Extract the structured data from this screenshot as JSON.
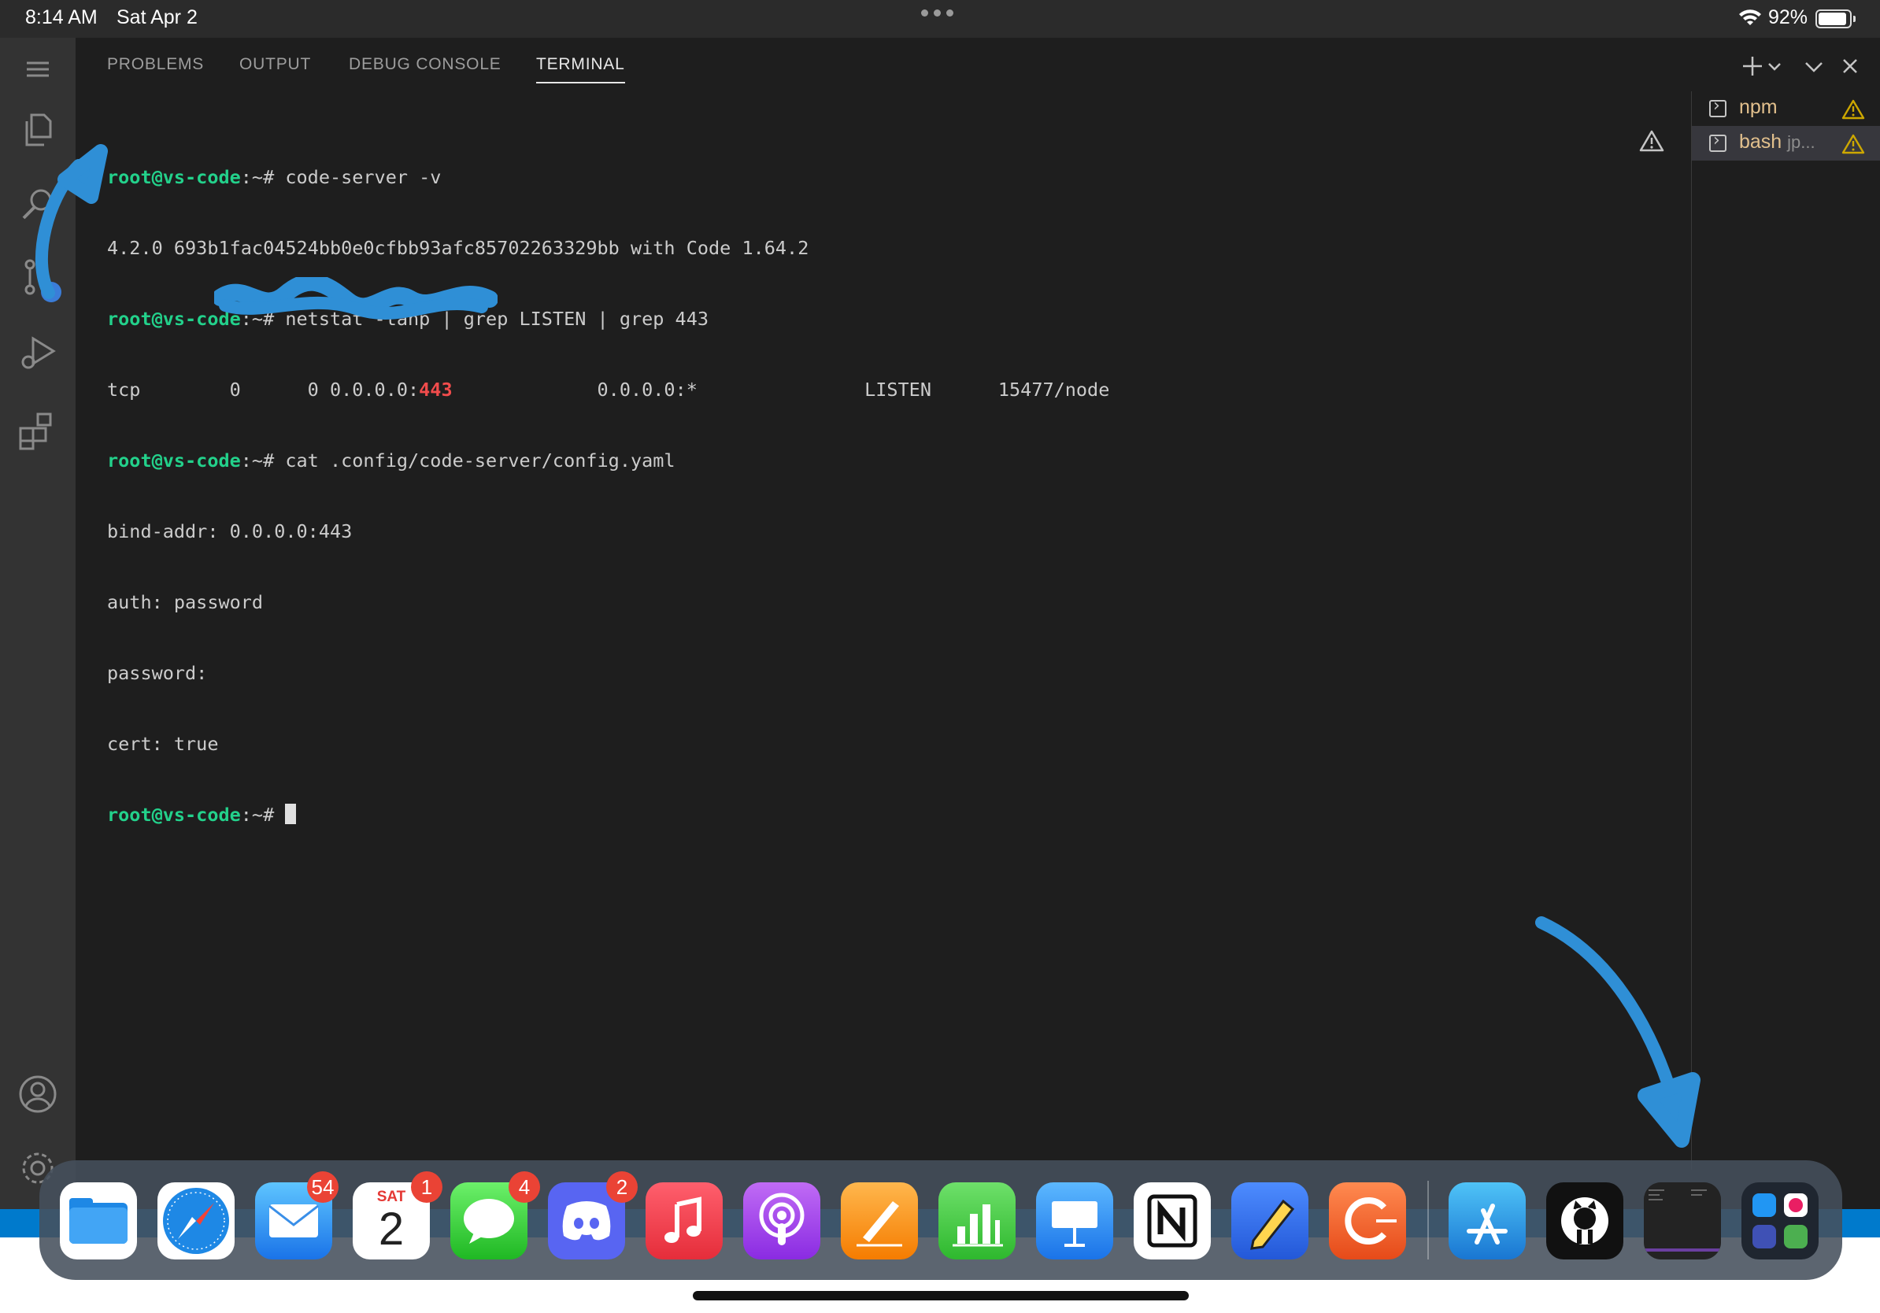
{
  "status_bar": {
    "time": "8:14 AM",
    "date": "Sat Apr 2",
    "battery": "92%"
  },
  "panel": {
    "tabs": [
      {
        "label": "PROBLEMS"
      },
      {
        "label": "OUTPUT"
      },
      {
        "label": "DEBUG CONSOLE"
      },
      {
        "label": "TERMINAL"
      }
    ]
  },
  "terminal": {
    "prompt_user": "root@vs-code",
    "prompt_path": ":~# ",
    "lines": {
      "cmd1": "code-server -v",
      "out1": "4.2.0 693b1fac04524bb0e0cfbb93afc85702263329bb with Code 1.64.2",
      "cmd2": "netstat -tanp | grep LISTEN | grep 443",
      "out2a": "tcp        0      0 0.0.0.0:",
      "out2port": "443",
      "out2b": "             0.0.0.0:*               LISTEN      15477/node",
      "cmd3": "cat .config/code-server/config.yaml",
      "out3": "bind-addr: 0.0.0.0:443",
      "out4": "auth: password",
      "out5": "password: ",
      "out6": "cert: true"
    }
  },
  "terminal_list": [
    {
      "name": "npm",
      "sub": ""
    },
    {
      "name": "bash",
      "sub": "jp..."
    }
  ],
  "dock": {
    "badges": {
      "mail": "54",
      "calendar": "1",
      "messages": "4",
      "discord": "2"
    },
    "calendar_day": "SAT",
    "calendar_date": "2"
  },
  "colors": {
    "accent": "#007acc",
    "prompt_green": "#23d18b",
    "annotation_blue": "#2f8fd6",
    "warning": "#cca700"
  }
}
